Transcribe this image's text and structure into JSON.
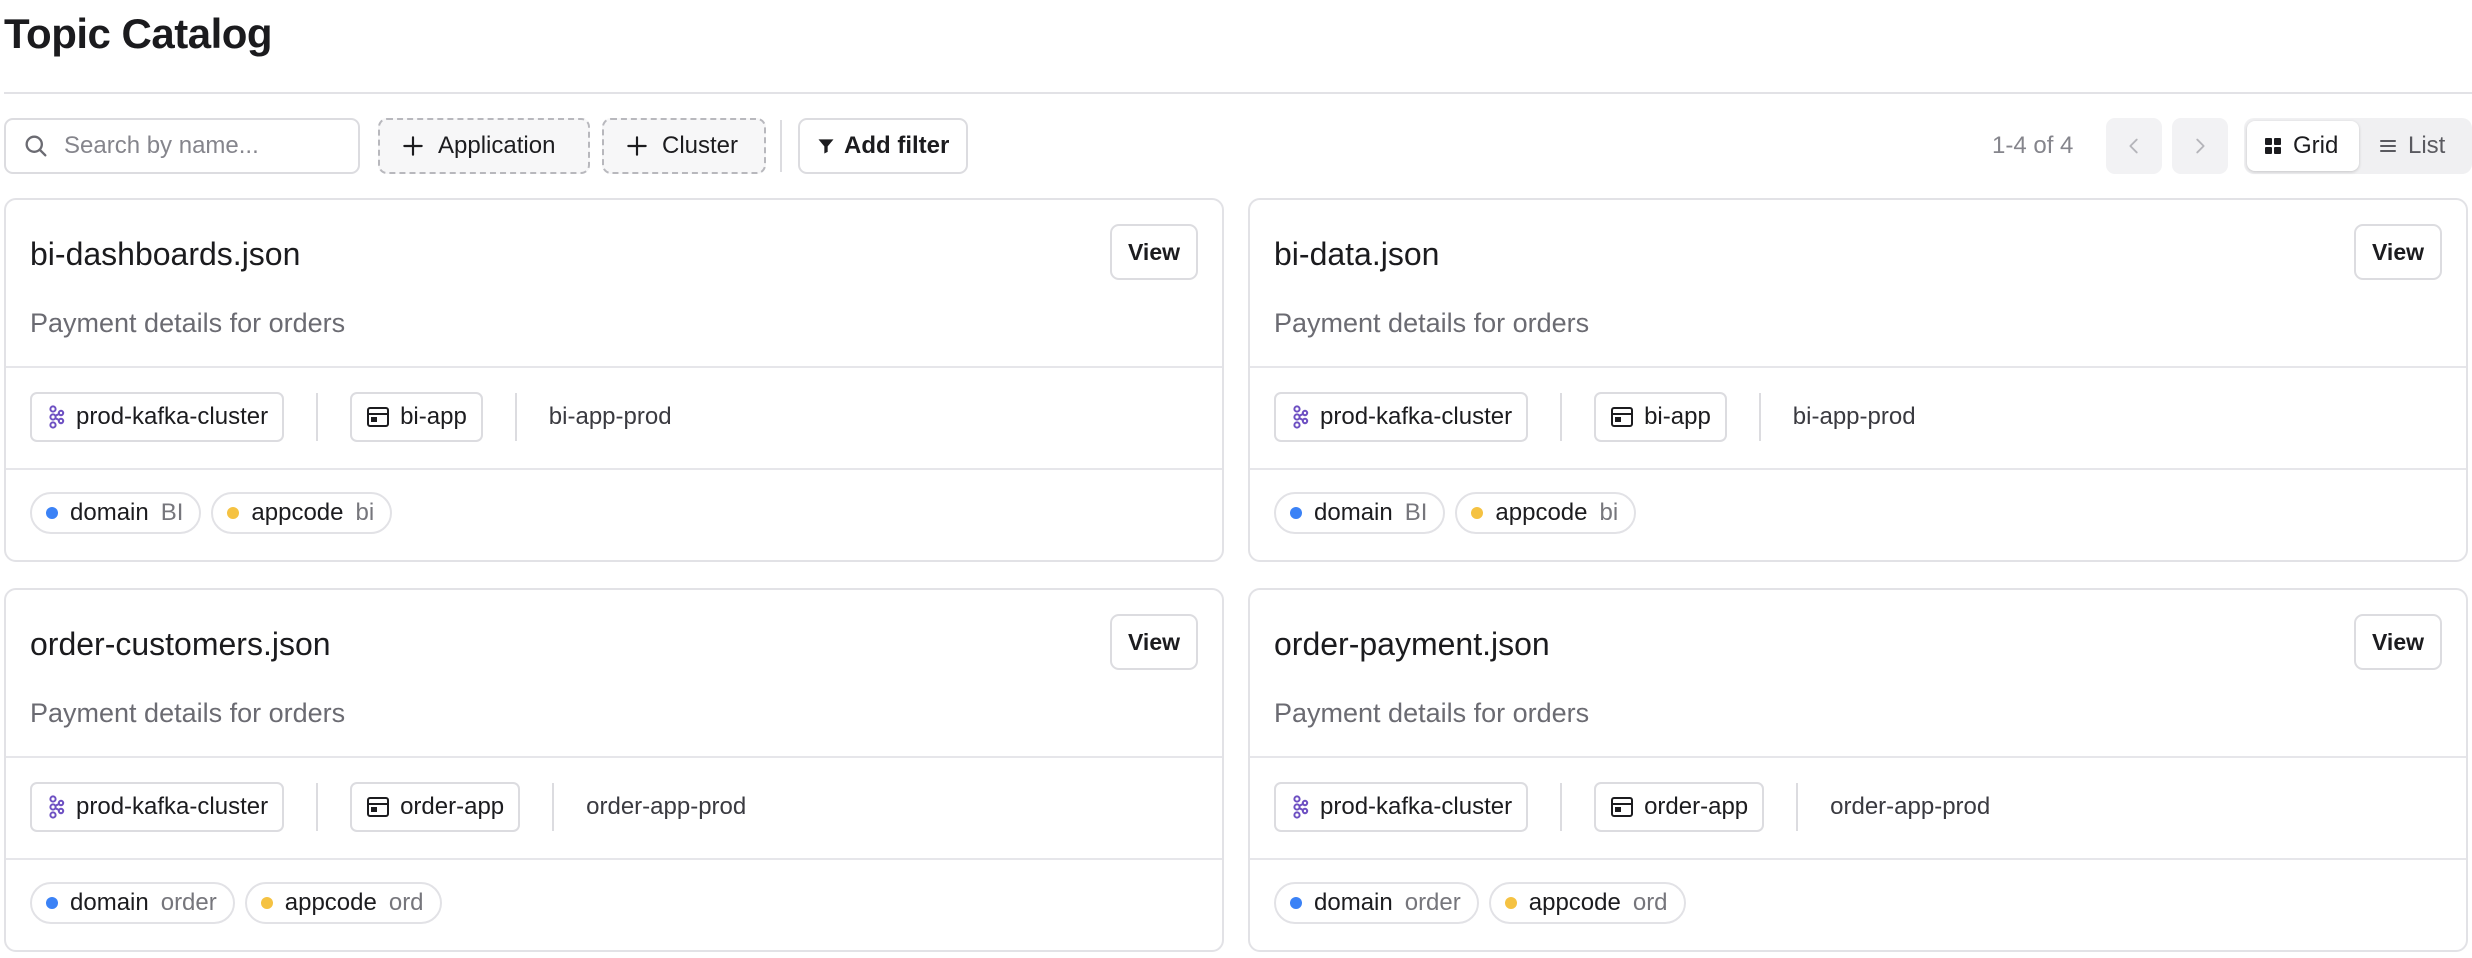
{
  "page": {
    "title": "Topic Catalog"
  },
  "toolbar": {
    "search_placeholder": "Search by name...",
    "filter_application": "Application",
    "filter_cluster": "Cluster",
    "add_filter": "Add filter",
    "pagination": "1-4 of 4",
    "view_grid": "Grid",
    "view_list": "List",
    "active_view": "Grid"
  },
  "colors": {
    "domain_dot": "#3b82f6",
    "appcode_dot": "#f5c242",
    "cluster_icon": "#6d4fc2"
  },
  "topics": [
    {
      "name": "bi-dashboards.json",
      "description": "Payment details for orders",
      "view_label": "View",
      "cluster": "prod-kafka-cluster",
      "application": "bi-app",
      "environment": "bi-app-prod",
      "labels": [
        {
          "key": "domain",
          "value": "BI"
        },
        {
          "key": "appcode",
          "value": "bi"
        }
      ]
    },
    {
      "name": "bi-data.json",
      "description": "Payment details for orders",
      "view_label": "View",
      "cluster": "prod-kafka-cluster",
      "application": "bi-app",
      "environment": "bi-app-prod",
      "labels": [
        {
          "key": "domain",
          "value": "BI"
        },
        {
          "key": "appcode",
          "value": "bi"
        }
      ]
    },
    {
      "name": "order-customers.json",
      "description": "Payment details for orders",
      "view_label": "View",
      "cluster": "prod-kafka-cluster",
      "application": "order-app",
      "environment": "order-app-prod",
      "labels": [
        {
          "key": "domain",
          "value": "order"
        },
        {
          "key": "appcode",
          "value": "ord"
        }
      ]
    },
    {
      "name": "order-payment.json",
      "description": "Payment details for orders",
      "view_label": "View",
      "cluster": "prod-kafka-cluster",
      "application": "order-app",
      "environment": "order-app-prod",
      "labels": [
        {
          "key": "domain",
          "value": "order"
        },
        {
          "key": "appcode",
          "value": "ord"
        }
      ]
    }
  ]
}
